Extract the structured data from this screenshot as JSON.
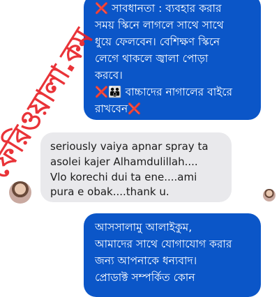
{
  "messages": {
    "top_outgoing": {
      "line1": "সাবধানতা : ব্যবহার করার",
      "line2": "সময় স্কিনে লাগলে সাথে সাথে",
      "line3": "ধুয়ে ফেলবেন। বেশিক্ষণ স্কিনে",
      "line4": "লেগে থাকলে জ্বালা পোড়া",
      "line5": "করবে।",
      "line6": "বাচ্চাদের নাগালের বাইরে",
      "line7": "রাখবেন"
    },
    "incoming": {
      "line1": "seriously vaiya apnar spray ta",
      "line2": "asolei kajer Alhamdulillah....",
      "line3": "Vlo korechi dui ta ene....ami",
      "line4": "pura e obak....thank u."
    },
    "bottom_outgoing": {
      "line1": "আসসালামু আলাইকুম,",
      "line2": "আমাদের সাথে যোগাযোগ করার",
      "line3": "জন্য আপনাকে  ধন্যবাদ।",
      "line4": "প্রোডাক্ট সম্পর্কিত কোন"
    }
  },
  "emoji": {
    "cross": "❌",
    "family": "👪"
  },
  "watermark": "ফেরিওয়ালা.কম",
  "colors": {
    "outgoing_bubble": "#0b56c8",
    "incoming_bubble": "#e9e9ec",
    "cross_mark": "#e0272b",
    "watermark": "#e8242a"
  },
  "icons": {
    "incoming_avatar": "avatar-photo",
    "read_receipt": "avatar-thumbnail"
  }
}
